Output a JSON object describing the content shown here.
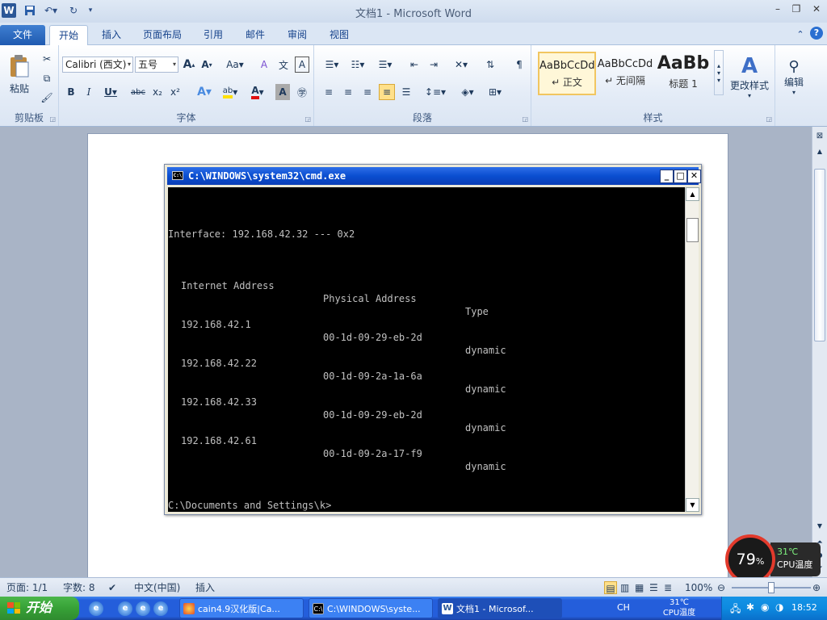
{
  "window": {
    "title": "文档1 - Microsoft Word",
    "app_icon": "W"
  },
  "ribbon_tabs": [
    "文件",
    "开始",
    "插入",
    "页面布局",
    "引用",
    "邮件",
    "审阅",
    "视图"
  ],
  "ribbon": {
    "clipboard": {
      "paste_label": "粘贴",
      "group_label": "剪贴板"
    },
    "font": {
      "group_label": "字体",
      "font_name": "Calibri (西文)",
      "font_size": "五号",
      "bold": "B",
      "italic": "I",
      "underline": "U",
      "strike": "abc",
      "subscript": "x₂",
      "superscript": "x²",
      "grow": "A",
      "shrink": "A",
      "case": "Aa",
      "clear": "A",
      "phonetic": "文",
      "border": "A"
    },
    "paragraph": {
      "group_label": "段落"
    },
    "styles": {
      "group_label": "样式",
      "items": [
        {
          "sample": "AaBbCcDd",
          "name": "↵ 正文"
        },
        {
          "sample": "AaBbCcDd",
          "name": "↵ 无间隔"
        },
        {
          "sample": "AaBb",
          "name": "标题 1"
        }
      ],
      "change_styles": "更改样式"
    },
    "editing": {
      "label": "编辑"
    }
  },
  "cmd": {
    "title": "C:\\WINDOWS\\system32\\cmd.exe",
    "interface_line": "Interface: 192.168.42.32 --- 0x2",
    "headers": [
      "Internet Address",
      "Physical Address",
      "Type"
    ],
    "rows": [
      [
        "192.168.42.1",
        "00-1d-09-29-eb-2d",
        "dynamic"
      ],
      [
        "192.168.42.22",
        "00-1d-09-2a-1a-6a",
        "dynamic"
      ],
      [
        "192.168.42.33",
        "00-1d-09-29-eb-2d",
        "dynamic"
      ],
      [
        "192.168.42.61",
        "00-1d-09-2a-17-f9",
        "dynamic"
      ]
    ],
    "prompt": "C:\\Documents and Settings\\k>"
  },
  "cpu_widget": {
    "usage": "79",
    "usage_unit": "%",
    "temp": "31℃",
    "temp_label": "CPU温度"
  },
  "statusbar": {
    "page": "页面: 1/1",
    "words": "字数: 8",
    "language": "中文(中国)",
    "mode": "插入",
    "zoom": "100%"
  },
  "taskbar": {
    "start_label": "开始",
    "tasks": [
      {
        "label": "cain4.9汉化版|Ca..."
      },
      {
        "label": "C:\\WINDOWS\\syste..."
      },
      {
        "label": "文档1 - Microsof..."
      }
    ],
    "lang": "CH",
    "tray_temp": "31℃",
    "tray_temp_label": "CPU温度",
    "clock": "18:52"
  }
}
